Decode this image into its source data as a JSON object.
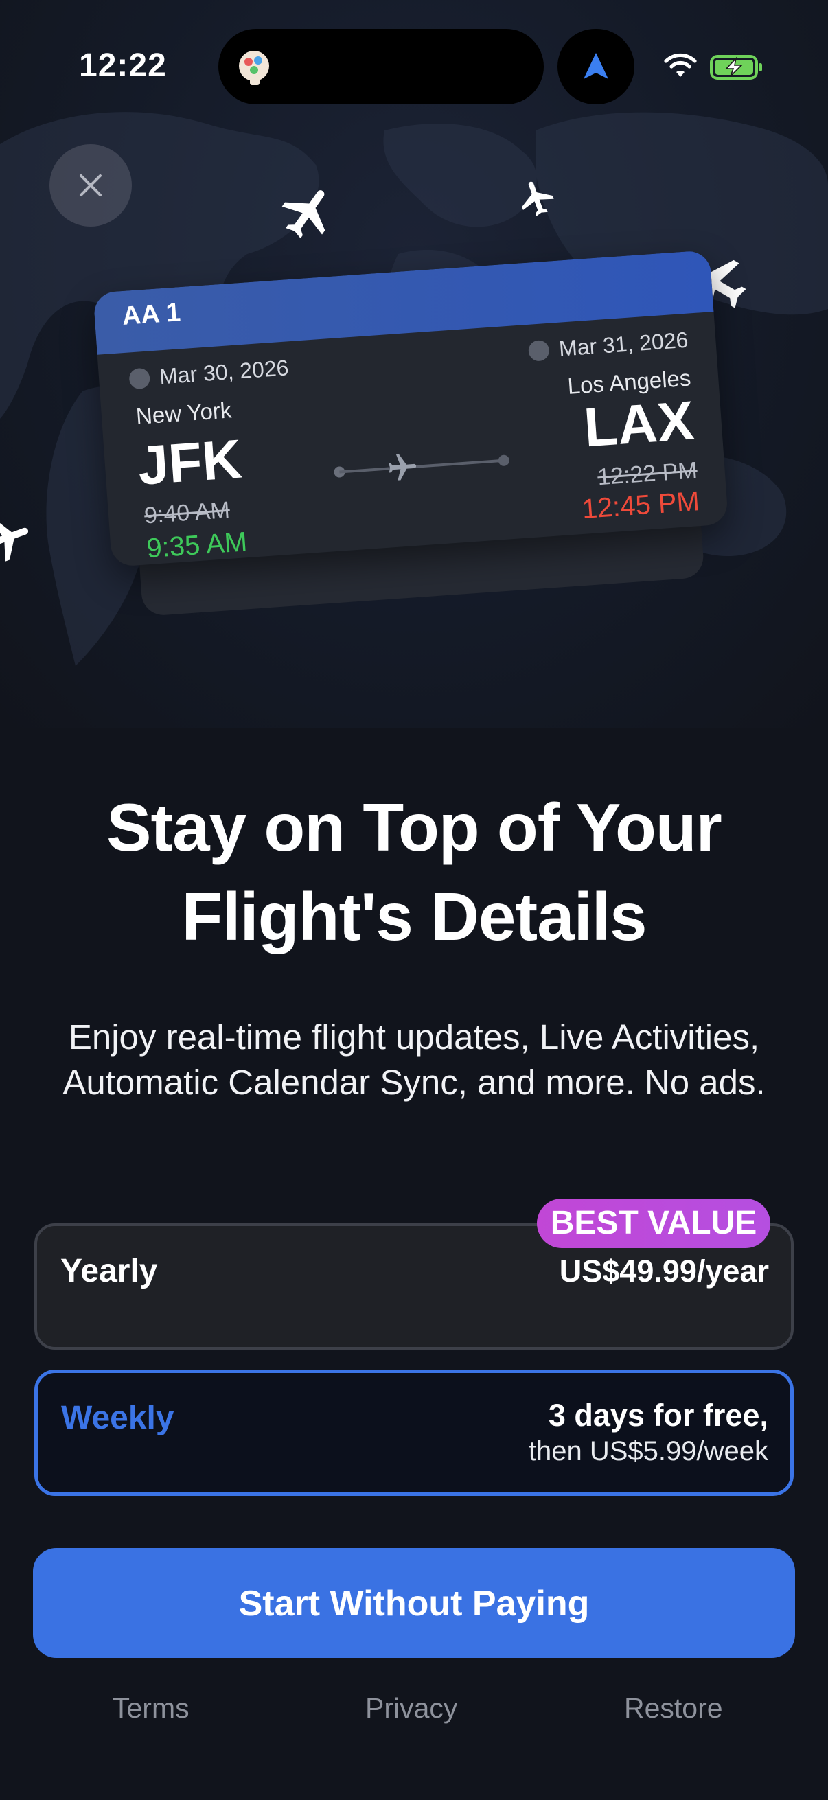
{
  "status_bar": {
    "time": "12:22"
  },
  "card": {
    "flight_number": "AA 1",
    "departure": {
      "date": "Mar 30, 2026",
      "city": "New York",
      "code": "JFK",
      "scheduled": "9:40 AM",
      "actual": "9:35 AM"
    },
    "arrival": {
      "date": "Mar 31, 2026",
      "city": "Los Angeles",
      "code": "LAX",
      "scheduled": "12:22 PM",
      "actual": "12:45 PM"
    }
  },
  "headline": {
    "line1": "Stay on Top of Your",
    "line2": "Flight's Details"
  },
  "subtitle": {
    "line1": "Enjoy real-time flight updates, Live Activities,",
    "line2": "Automatic Calendar Sync, and more. No ads."
  },
  "plans": {
    "badge": "BEST VALUE",
    "yearly": {
      "name": "Yearly",
      "price": "US$49.99/year"
    },
    "weekly": {
      "name": "Weekly",
      "trial": "3 days for free,",
      "then": "then US$5.99/week"
    }
  },
  "cta_label": "Start Without Paying",
  "footer": {
    "terms": "Terms",
    "privacy": "Privacy",
    "restore": "Restore"
  },
  "colors": {
    "accent": "#3b74e6",
    "badge": "#c147d6",
    "on_time_green": "#3ec95a",
    "delay_red": "#ef4a3a",
    "background": "#11141c"
  },
  "icons": [
    "close-icon",
    "airplane-icon",
    "navigation-arrow-icon",
    "wifi-icon",
    "battery-charging-icon",
    "app-icon"
  ]
}
